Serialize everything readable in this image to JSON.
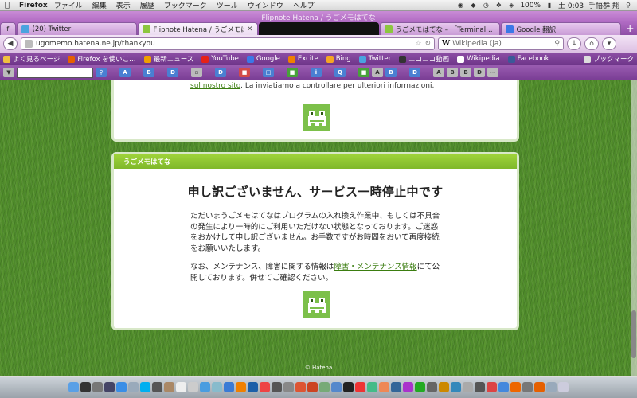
{
  "menubar": {
    "app_name": "Firefox",
    "menus": [
      "ファイル",
      "編集",
      "表示",
      "履歴",
      "ブックマーク",
      "ツール",
      "ウインドウ",
      "ヘルプ"
    ],
    "battery": "100%",
    "clock": "土 0:03",
    "user": "手悟群 翔"
  },
  "window": {
    "title": "Flipnote Hatena / うごメモはてな"
  },
  "tabs": [
    {
      "label": "(20) Twitter",
      "favicon_color": "#4aa3df"
    },
    {
      "label": "Flipnote Hatena / うごメモは…",
      "favicon_color": "#8cc63f",
      "active": true
    },
    {
      "label": "",
      "redacted": true
    },
    {
      "label": "うごメモはてな – 「Terminal…",
      "favicon_color": "#8cc63f"
    },
    {
      "label": "Google 翻訳",
      "favicon_color": "#3b78e7"
    }
  ],
  "navbar": {
    "url": "ugomemo.hatena.ne.jp/thankyou",
    "search_engine": "W",
    "search_placeholder": "Wikipedia (ja)"
  },
  "bookmarks": [
    {
      "label": "よく見るページ",
      "color": "#f0c040"
    },
    {
      "label": "Firefox を使いこ…",
      "color": "#e66000"
    },
    {
      "label": "最新ニュース",
      "color": "#f0a000"
    },
    {
      "label": "YouTube",
      "color": "#e62117"
    },
    {
      "label": "Google",
      "color": "#3b78e7"
    },
    {
      "label": "Excite",
      "color": "#f08000"
    },
    {
      "label": "Bing",
      "color": "#f5a623"
    },
    {
      "label": "Twitter",
      "color": "#4aa3df"
    },
    {
      "label": "ニコニコ動画",
      "color": "#333333"
    },
    {
      "label": "Wikipedia",
      "color": "#ffffff"
    },
    {
      "label": "Facebook",
      "color": "#3b5998"
    }
  ],
  "bookmarks_menu": "ブックマーク",
  "page": {
    "card1": {
      "link_text": "sul nostro sito",
      "text": ". La inviatiamo a controllare per ulteriori informazioni."
    },
    "card2": {
      "header": "うごメモはてな",
      "title": "申し訳ございません、サービス一時停止中です",
      "paragraph1": "ただいまうごメモはてなはプログラムの入れ換え作業中、もしくは不具合の発生により一時的にご利用いただけない状態となっております。ご迷惑をおかけして申し訳ございません。お手数ですがお時間をおいて再度接続をお願いいたします。",
      "paragraph2_before": "なお、メンテナンス、障害に関する情報は",
      "paragraph2_link": "障害・メンテナンス情報",
      "paragraph2_after": "にて公開しております。併せてご確認ください。"
    },
    "footer": "© Hatena"
  },
  "colors": {
    "accent_green": "#8cc63f",
    "link_green": "#3b7d10",
    "theme_purple": "#8e4da6"
  }
}
